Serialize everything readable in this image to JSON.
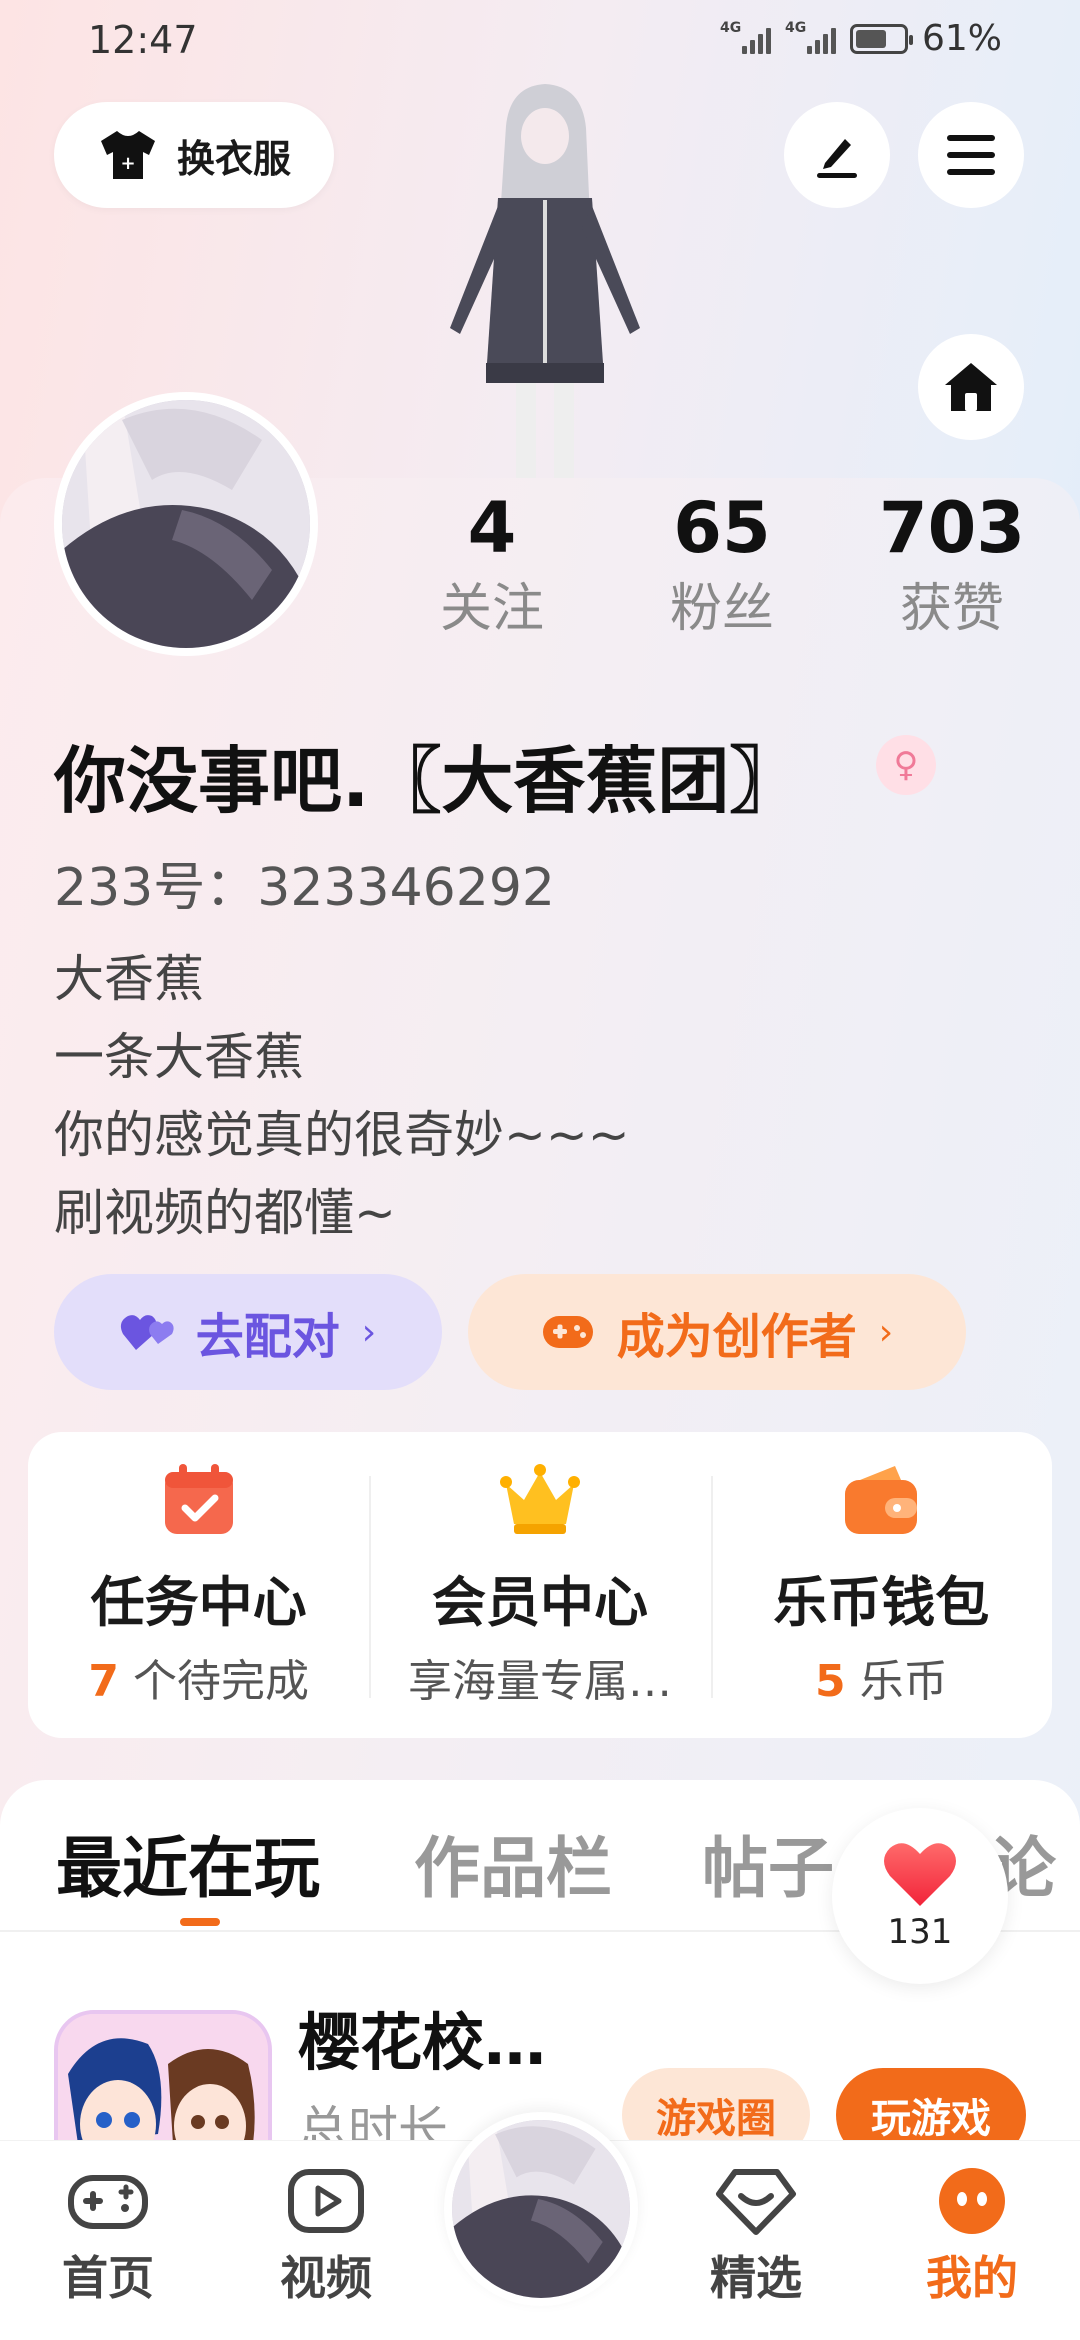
{
  "status_bar": {
    "time": "12:47",
    "network_1": "4G",
    "network_2": "4G",
    "battery": "61%"
  },
  "top": {
    "dress_label": "换衣服"
  },
  "stats": [
    {
      "value": "4",
      "label": "关注"
    },
    {
      "value": "65",
      "label": "粉丝"
    },
    {
      "value": "703",
      "label": "获赞"
    }
  ],
  "profile": {
    "name": "你没事吧.〖大香蕉团〗",
    "gender_symbol": "♀",
    "id_line": "233号：323346292",
    "bio": [
      "大香蕉",
      "一条大香蕉",
      "你的感觉真的很奇妙~~~",
      "刷视频的都懂~"
    ]
  },
  "actions": {
    "match_label": "去配对",
    "creator_label": "成为创作者",
    "chevron": "›"
  },
  "services": [
    {
      "icon": "calendar-check-icon",
      "title": "任务中心",
      "sub_num": "7",
      "sub_text": " 个待完成"
    },
    {
      "icon": "crown-icon",
      "title": "会员中心",
      "sub_num": "",
      "sub_text": "享海量专属…"
    },
    {
      "icon": "wallet-icon",
      "title": "乐币钱包",
      "sub_num": "5",
      "sub_text": " 乐币"
    }
  ],
  "tabs": [
    "最近在玩",
    "作品栏",
    "帖子",
    "评论"
  ],
  "like_count": "131",
  "recent_game": {
    "title": "樱花校…",
    "subtitle": "总时长",
    "circle_label": "游戏圈",
    "play_label": "玩游戏"
  },
  "bottom_nav": [
    {
      "icon": "gamepad-icon",
      "label": "首页"
    },
    {
      "icon": "video-play-icon",
      "label": "视频"
    },
    {
      "icon": "heart-bubble-icon",
      "label": "精选"
    },
    {
      "icon": "face-icon",
      "label": "我的"
    }
  ],
  "colors": {
    "accent": "#f26b1a",
    "match_purple": "#6b55e0",
    "gender_pink": "#f07a98"
  }
}
